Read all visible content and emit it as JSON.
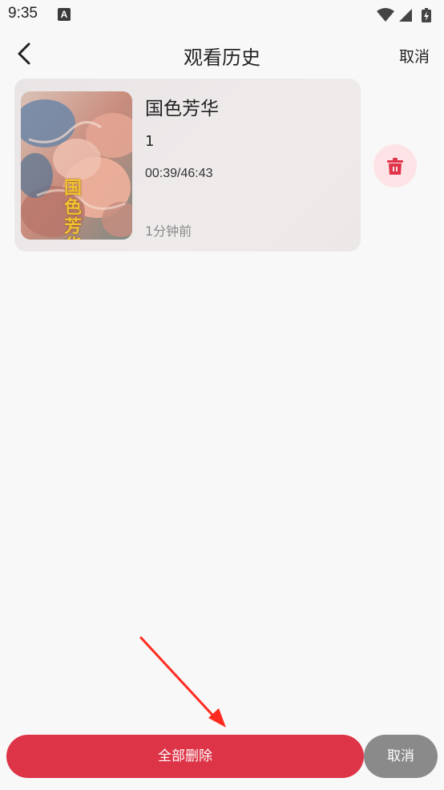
{
  "status_bar": {
    "time": "9:35",
    "notification_icon": "A"
  },
  "nav": {
    "title": "观看历史",
    "cancel_label": "取消"
  },
  "history": {
    "items": [
      {
        "title": "国色芳华",
        "episode": "1",
        "progress": "00:39/46:43",
        "watched_ago": "1分钟前",
        "poster_text": "国色芳华"
      }
    ]
  },
  "footer": {
    "delete_all_label": "全部删除",
    "cancel_label": "取消"
  },
  "colors": {
    "delete_all_bg": "#dd3447",
    "cancel_bg": "#8a8a8a",
    "delete_icon": "#e0344a",
    "delete_icon_bg": "#fde3e5",
    "annotation_arrow": "#ff2a1f"
  },
  "icons": {
    "back": "chevron-left-icon",
    "delete_item": "trash-icon",
    "wifi": "wifi-icon",
    "signal": "signal-icon",
    "battery": "battery-icon"
  }
}
